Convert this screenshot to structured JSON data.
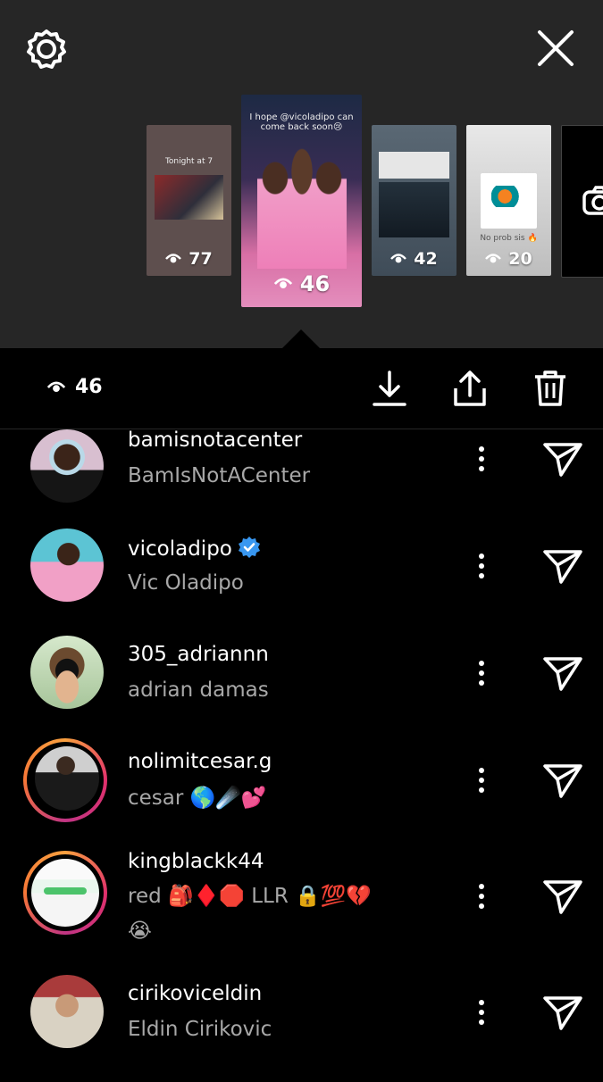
{
  "stories": [
    {
      "caption": "Tonight at 7",
      "views": "77"
    },
    {
      "caption": "I hope @vicoladipo can come back soon😢",
      "views": "46"
    },
    {
      "caption": "",
      "views": "42"
    },
    {
      "caption": "No prob sis 🔥",
      "views": "20"
    }
  ],
  "action_bar": {
    "view_count": "46"
  },
  "viewers": [
    {
      "username": "bamisnotacenter",
      "full_name": "BamIsNotACenter",
      "verified": false
    },
    {
      "username": "vicoladipo",
      "full_name": "Vic Oladipo",
      "verified": true
    },
    {
      "username": "305_adriannn",
      "full_name": "adrian damas",
      "verified": false
    },
    {
      "username": "nolimitcesar.g",
      "full_name": "cesar 🌎☄️💕",
      "verified": false
    },
    {
      "username": "kingblackk44",
      "full_name": "red 🎒♦️🛑 LLR 🔒💯💔",
      "full_name_line2": "😭",
      "verified": false
    },
    {
      "username": "cirikoviceldin",
      "full_name": "Eldin Cirikovic",
      "verified": false
    }
  ],
  "colors": {
    "top_panel": "#262626",
    "background": "#000000",
    "secondary_text": "#a8a8a8",
    "verified_badge": "#3897f0"
  }
}
